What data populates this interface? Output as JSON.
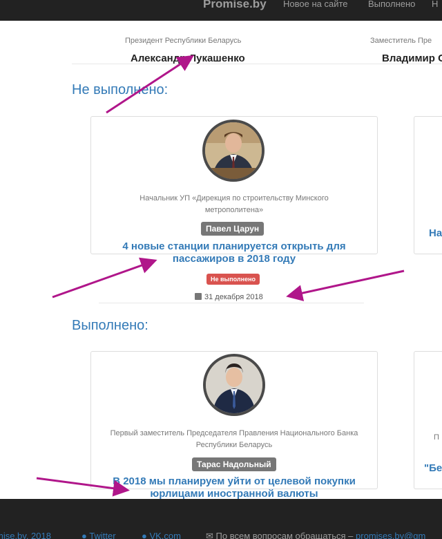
{
  "navbar": {
    "brand": "Promise.by",
    "links": [
      "Новое на сайте",
      "Выполнено",
      "Н"
    ]
  },
  "leaders": [
    {
      "title": "Президент Республики Беларусь",
      "name": "Александр Лукашенко"
    },
    {
      "title": "Заместитель Пре",
      "name": "Владимир С"
    }
  ],
  "sections": [
    {
      "title": "Не выполнено:",
      "card": {
        "position": "Начальник УП «Дирекция по строительству Минского метрополитена»",
        "person": "Павел Царун",
        "promise": "4 новые станции планируется открыть для пассажиров в 2018 году",
        "status": "Не выполнено",
        "date": "31 декабря 2018",
        "side_text": "На"
      }
    },
    {
      "title": "Выполнено:",
      "card": {
        "position": "Первый заместитель Председателя Правления Национального Банка Республики Беларусь",
        "person": "Тарас Надольный",
        "promise": "В 2018 мы планируем уйти от целевой покупки юрлицами иностранной валюты",
        "side_text": "\"Бе",
        "side_position": "П"
      }
    }
  ],
  "footer": {
    "copyright": "mise.by, 2018",
    "twitter": "Twitter",
    "vk": "VK.com",
    "contact": "По всем вопросам обращаться –",
    "email": "promises.by@gm"
  },
  "colors": {
    "link": "#337ab7",
    "status_red": "#d9534f",
    "label_gray": "#777777",
    "navbar_bg": "#222222",
    "arrow": "#b0168a"
  }
}
